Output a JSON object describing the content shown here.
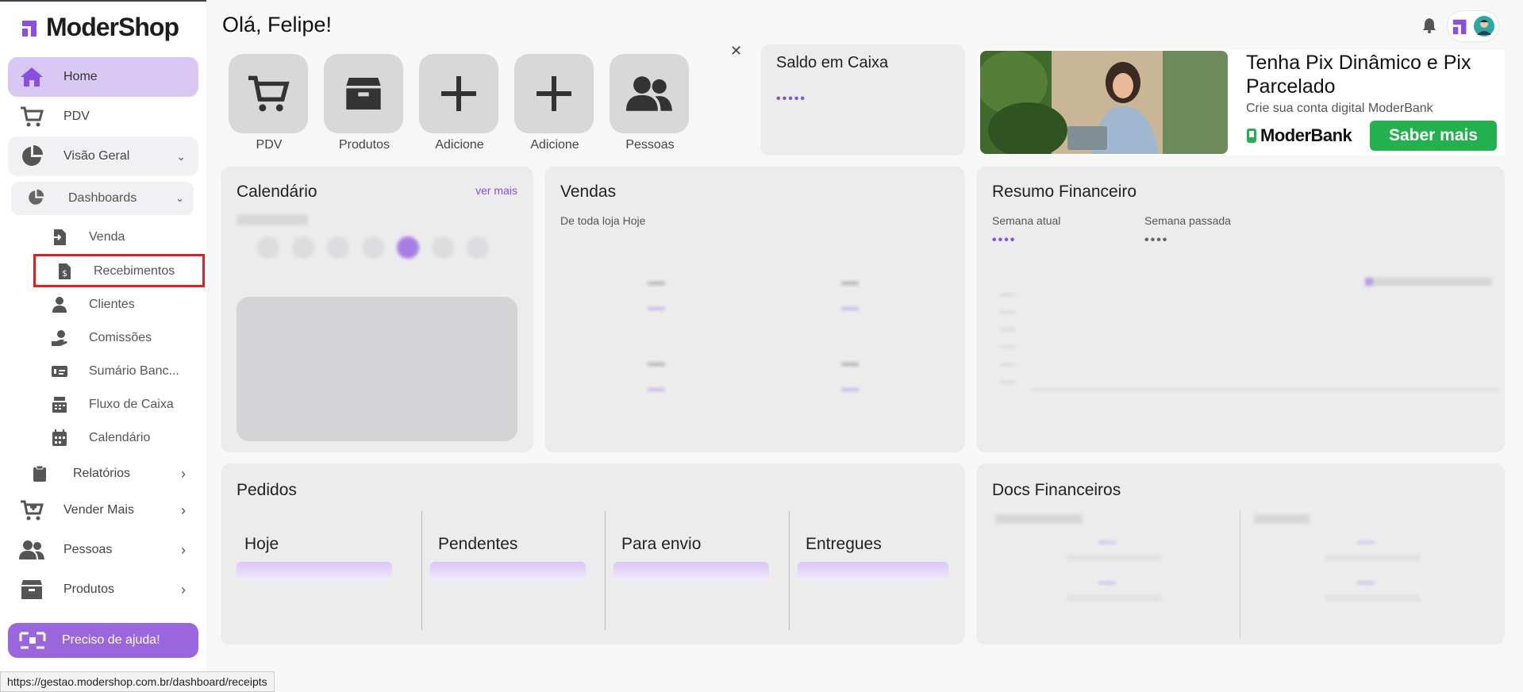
{
  "app": {
    "brand": "ModerShop"
  },
  "header": {
    "greeting": "Olá, Felipe!"
  },
  "sidebar": {
    "home": "Home",
    "pdv": "PDV",
    "visao_geral": "Visão Geral",
    "dashboards": "Dashboards",
    "leaves": [
      "Venda",
      "Recebimentos",
      "Clientes",
      "Comissões",
      "Sumário Banc...",
      "Fluxo de Caixa",
      "Calendário"
    ],
    "relatorios": "Relatórios",
    "vender_mais": "Vender Mais",
    "pessoas": "Pessoas",
    "produtos": "Produtos",
    "help": "Preciso de ajuda!"
  },
  "shortcuts": [
    "PDV",
    "Produtos",
    "Adicione",
    "Adicione",
    "Pessoas"
  ],
  "saldo": {
    "title": "Saldo em Caixa",
    "value": "•••••"
  },
  "banner": {
    "title": "Tenha Pix Dinâmico e Pix Parcelado",
    "subtitle": "Crie sua conta digital ModerBank",
    "brand": "ModerBank",
    "button": "Saber mais"
  },
  "calendario": {
    "title": "Calendário",
    "link": "ver mais"
  },
  "vendas": {
    "title": "Vendas",
    "subtitle": "De toda loja Hoje"
  },
  "resumo": {
    "title": "Resumo Financeiro",
    "col1": "Semana atual",
    "col2": "Semana passada",
    "val1": "••••",
    "val2": "••••"
  },
  "pedidos": {
    "title": "Pedidos",
    "cols": [
      "Hoje",
      "Pendentes",
      "Para envio",
      "Entregues"
    ]
  },
  "docs": {
    "title": "Docs Financeiros"
  },
  "status_bar": {
    "url": "https://gestao.modershop.com.br/dashboard/receipts"
  },
  "colors": {
    "accent": "#9a66dd",
    "active_bg": "#d9c8f3",
    "cta_green": "#22b14c",
    "highlight_red": "#e02020"
  }
}
